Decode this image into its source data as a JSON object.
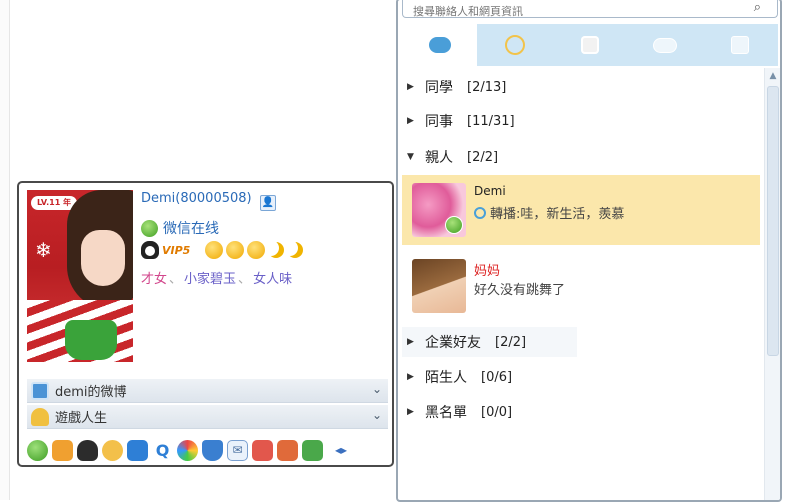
{
  "search": {
    "placeholder": "搜尋聯絡人和網頁資訊"
  },
  "tabs": [
    {
      "name": "chat"
    },
    {
      "name": "qzone"
    },
    {
      "name": "group"
    },
    {
      "name": "discussion"
    },
    {
      "name": "recent"
    }
  ],
  "groups": [
    {
      "name": "同學",
      "count": "[2/13]",
      "expanded": false
    },
    {
      "name": "同事",
      "count": "[11/31]",
      "expanded": false
    },
    {
      "name": "親人",
      "count": "[2/2]",
      "expanded": true
    },
    {
      "name": "企業好友",
      "count": "[2/2]",
      "expanded": false
    },
    {
      "name": "陌生人",
      "count": "[0/6]",
      "expanded": false
    },
    {
      "name": "黑名單",
      "count": "[0/0]",
      "expanded": false
    }
  ],
  "contacts": [
    {
      "name": "Demi",
      "message": "轉播:哇，新生活，羨慕",
      "selected": true
    },
    {
      "name": "妈妈",
      "message": "好久没有跳舞了",
      "selected": false
    }
  ],
  "profile": {
    "name": "Demi",
    "qq": "(80000508)",
    "status": "微信在线",
    "vip": "VIP5",
    "tags": [
      "才女",
      "小家碧玉",
      "女人味"
    ],
    "tag_separator": "、",
    "avatar_badge": "LV.11 年",
    "rows": [
      {
        "label": "demi的微博",
        "icon": "weibo-icon"
      },
      {
        "label": "遊戲人生",
        "icon": "game-icon"
      }
    ]
  },
  "colors": {
    "selected_bg": "#fbe7ab",
    "link_blue": "#2a6ab7",
    "tab_bg": "#cfe6f5"
  }
}
